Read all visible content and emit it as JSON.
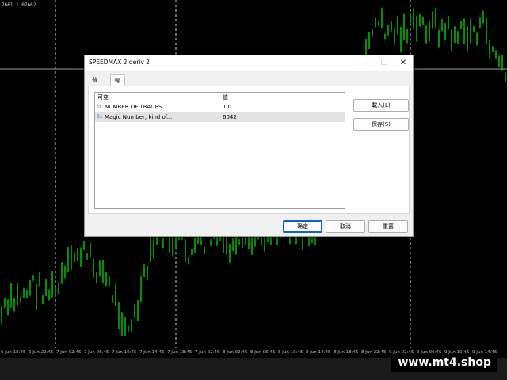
{
  "chart": {
    "price_readout": "7661 1.07662",
    "line_color": "#00d000",
    "time_ticks": [
      "6 Jun 18:45",
      "6 Jun 22:45",
      "7 Jun 02:45",
      "7 Jun 06:45",
      "7 Jun 10:45",
      "7 Jun 14:45",
      "7 Jun 18:45",
      "7 Jun 22:45",
      "8 Jun 02:45",
      "8 Jun 06:45",
      "8 Jun 10:45",
      "8 Jun 14:45",
      "8 Jun 18:45",
      "8 Jun 22:45",
      "9 Jun 02:45",
      "9 Jun 06:45",
      "9 Jun 10:45",
      "9 Jun 14:45"
    ]
  },
  "brand_text": "www.mt4.shop",
  "dialog": {
    "title": "SPEEDMAX 2 deriv 2",
    "window_controls": {
      "minimize": "—",
      "maximize": "☐",
      "close": "✕"
    },
    "tabs": [
      {
        "label": "普通",
        "active": false
      },
      {
        "label": "輸入",
        "active": true
      }
    ],
    "table": {
      "columns": [
        "可变",
        "值"
      ],
      "rows": [
        {
          "icon": "½",
          "name": "NUMBER OF TRADES",
          "value": "1.0",
          "selected": false
        },
        {
          "icon": "01",
          "name": "Magic Number, kind of...",
          "value": "6042",
          "selected": true
        }
      ]
    },
    "side_buttons": {
      "load": "載入(L)",
      "save": "保存(S)"
    },
    "footer_buttons": {
      "ok": "确定",
      "cancel": "取消",
      "reset": "重置"
    }
  }
}
